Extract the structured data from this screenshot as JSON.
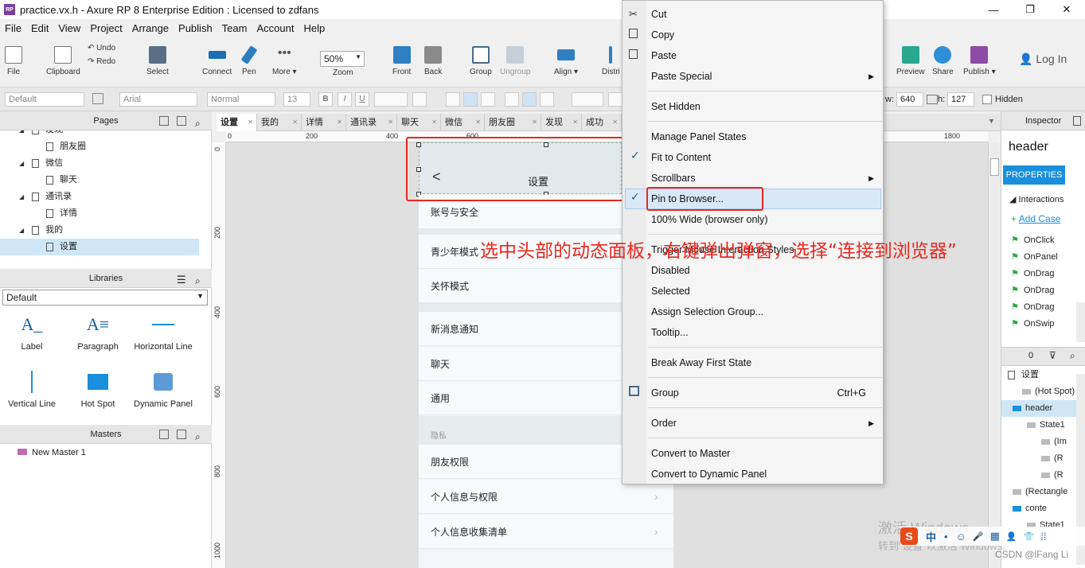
{
  "titlebar": {
    "title": "practice.vx.h - Axure RP 8 Enterprise Edition : Licensed to zdfans",
    "app_icon": "RP",
    "minimize": "—",
    "restore": "❐",
    "close": "✕"
  },
  "menu": [
    "File",
    "Edit",
    "View",
    "Project",
    "Arrange",
    "Publish",
    "Team",
    "Account",
    "Help"
  ],
  "toolbar": {
    "file": "File",
    "clipboard": "Clipboard",
    "undo": "Undo",
    "redo": "Redo",
    "select": "Select",
    "connect": "Connect",
    "pen": "Pen",
    "more": "More ▾",
    "zoom_value": "50%",
    "zoom": "Zoom",
    "front": "Front",
    "back": "Back",
    "group": "Group",
    "ungroup": "Ungroup",
    "align": "Align ▾",
    "distribute": "Distri",
    "preview": "Preview",
    "share": "Share",
    "publish": "Publish ▾",
    "login": "Log In"
  },
  "formatbar": {
    "style": "Default",
    "font": "Arial",
    "weight": "Normal",
    "size": "13",
    "bold": "B",
    "italic": "I",
    "underline": "U",
    "w_label": "w:",
    "w": "640",
    "h_label": "h:",
    "h": "127",
    "hidden": "Hidden"
  },
  "pages": {
    "title": "Pages",
    "items": [
      {
        "label": "发现",
        "indent": 1,
        "expander": true
      },
      {
        "label": "朋友圈",
        "indent": 2,
        "expander": false
      },
      {
        "label": "微信",
        "indent": 1,
        "expander": true
      },
      {
        "label": "聊天",
        "indent": 2,
        "expander": false
      },
      {
        "label": "通讯录",
        "indent": 1,
        "expander": true
      },
      {
        "label": "详情",
        "indent": 2,
        "expander": false
      },
      {
        "label": "我的",
        "indent": 1,
        "expander": true
      },
      {
        "label": "设置",
        "indent": 2,
        "expander": false,
        "selected": true
      }
    ]
  },
  "libraries": {
    "title": "Libraries",
    "selected": "Default",
    "items": [
      "Label",
      "Paragraph",
      "Horizontal Line",
      "Vertical Line",
      "Hot Spot",
      "Dynamic Panel"
    ]
  },
  "masters": {
    "title": "Masters",
    "items": [
      "New Master 1"
    ]
  },
  "tabs": [
    "设置",
    "我的",
    "详情",
    "通讯录",
    "聊天",
    "微信",
    "朋友圈",
    "发现",
    "成功"
  ],
  "ruler_h": [
    "0",
    "200",
    "400",
    "600",
    "1800"
  ],
  "ruler_v": [
    "0",
    "200",
    "400",
    "600",
    "800",
    "1000"
  ],
  "phone": {
    "header_title": "设置",
    "back": "<",
    "rows": [
      {
        "label": "账号与安全",
        "chevron": false
      },
      {
        "label": "青少年模式",
        "chevron": false
      },
      {
        "label": "关怀模式",
        "chevron": false
      },
      {
        "label": "新消息通知",
        "chevron": false
      },
      {
        "label": "聊天",
        "chevron": false
      },
      {
        "label": "通用",
        "chevron": false
      },
      {
        "label": "朋友权限",
        "chevron": false
      },
      {
        "label": "个人信息与权限",
        "chevron": true
      },
      {
        "label": "个人信息收集清单",
        "chevron": true
      }
    ],
    "section": "隐私"
  },
  "context_menu": {
    "cut": "Cut",
    "copy": "Copy",
    "paste": "Paste",
    "paste_special": "Paste Special",
    "set_hidden": "Set Hidden",
    "manage": "Manage Panel States",
    "fit": "Fit to Content",
    "scrollbars": "Scrollbars",
    "pin": "Pin to Browser...",
    "wide": "100% Wide (browser only)",
    "trigger": "Trigger Mouse Interaction Styles",
    "disabled": "Disabled",
    "selected": "Selected",
    "assign": "Assign Selection Group...",
    "tooltip": "Tooltip...",
    "break": "Break Away First State",
    "group": "Group",
    "group_shortcut": "Ctrl+G",
    "order": "Order",
    "convert_master": "Convert to Master",
    "convert_dynamic": "Convert to Dynamic Panel",
    "arrow": "▶",
    "check": "✓"
  },
  "annotation": "选中头部的动态面板，右键弹出弹窗，选择“连接到浏览器”",
  "inspector": {
    "title": "Inspector",
    "name": "header",
    "properties": "PROPERTIES",
    "interactions": "Interactions",
    "add_case": "Add Case",
    "events": [
      "OnClick",
      "OnPanel",
      "OnDrag",
      "OnDrag",
      "OnDrag",
      "OnSwip"
    ]
  },
  "outline": {
    "page": "设置",
    "items": [
      "(Hot Spot)",
      "header",
      "State1",
      "(Im",
      "(R",
      "(R",
      "(Rectangle",
      "conte",
      "State1"
    ]
  },
  "watermark": {
    "line1": "激活 Windows",
    "line2": "转到“设置”以激活 Windows。",
    "csdn": "CSDN @lFang Li"
  },
  "taskbar": [
    "中",
    "•",
    "☺",
    "🎤",
    "▦",
    "👤",
    "👕",
    "⁞⁞"
  ],
  "colors": {
    "accent": "#1a8fdb",
    "annotation": "#e8281e",
    "highlight_box": "#e8281e",
    "selection": "#cfe6f7"
  }
}
